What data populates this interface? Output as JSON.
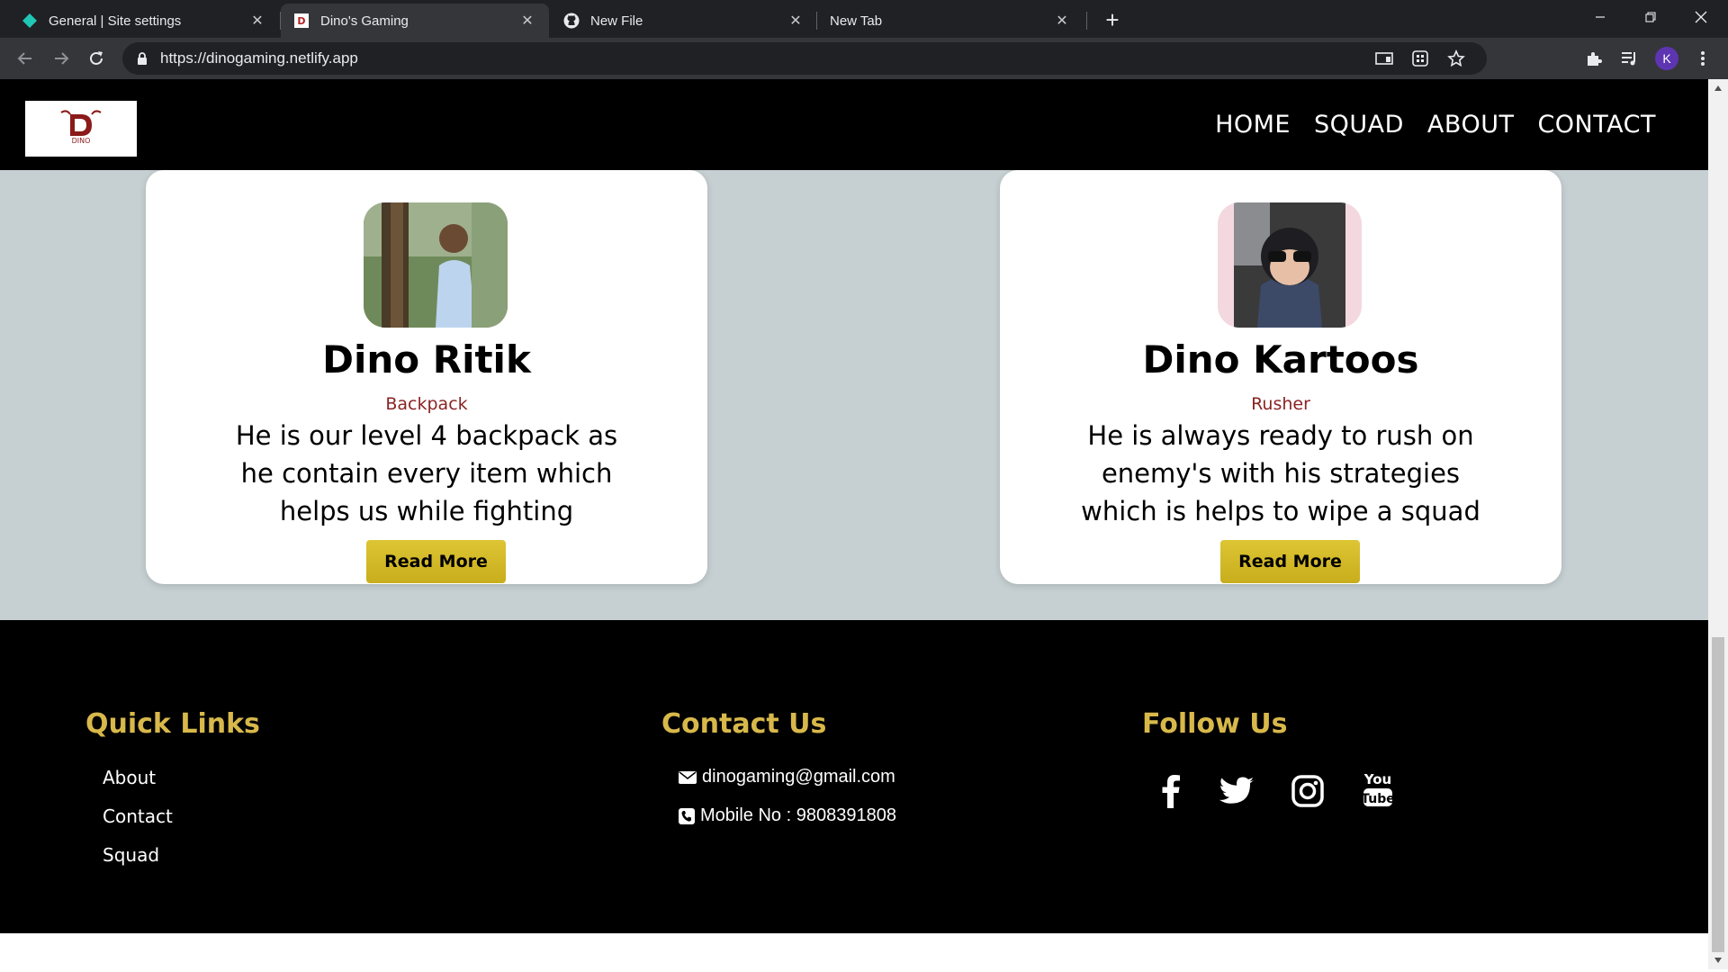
{
  "browser": {
    "tabs": [
      {
        "title": "General | Site settings",
        "icon": "netlify-icon",
        "active": false
      },
      {
        "title": "Dino's Gaming",
        "icon": "dino-favicon-icon",
        "active": true
      },
      {
        "title": "New File",
        "icon": "github-icon",
        "active": false
      },
      {
        "title": "New Tab",
        "icon": "",
        "active": false
      }
    ],
    "url": "https://dinogaming.netlify.app",
    "profile_initial": "K",
    "profile_color": "#5e35b1"
  },
  "site": {
    "logo_text": "DINO",
    "nav": [
      "HOME",
      "SQUAD",
      "ABOUT",
      "CONTACT"
    ],
    "players": [
      {
        "name": "Dino Ritik",
        "role": "Backpack",
        "description": "He is our level 4 backpack as he contain every item which helps us while fighting",
        "button": "Read More"
      },
      {
        "name": "Dino Kartoos",
        "role": "Rusher",
        "description": "He is always ready to rush on enemy's with his strategies which is helps to wipe a squad",
        "button": "Read More"
      }
    ],
    "footer": {
      "quick_links": {
        "heading": "Quick Links",
        "items": [
          "About",
          "Contact",
          "Squad"
        ]
      },
      "contact": {
        "heading": "Contact Us",
        "email": "dinogaming@gmail.com",
        "phone": "Mobile No : 9808391808"
      },
      "follow": {
        "heading": "Follow Us",
        "icons": [
          "facebook-icon",
          "twitter-icon",
          "instagram-icon",
          "youtube-icon"
        ]
      }
    },
    "colors": {
      "accent_gold": "#d8b84a",
      "button_gold": "#d4bb2a",
      "role_red": "#8b2323",
      "squad_bg": "#c6d0d2"
    }
  }
}
